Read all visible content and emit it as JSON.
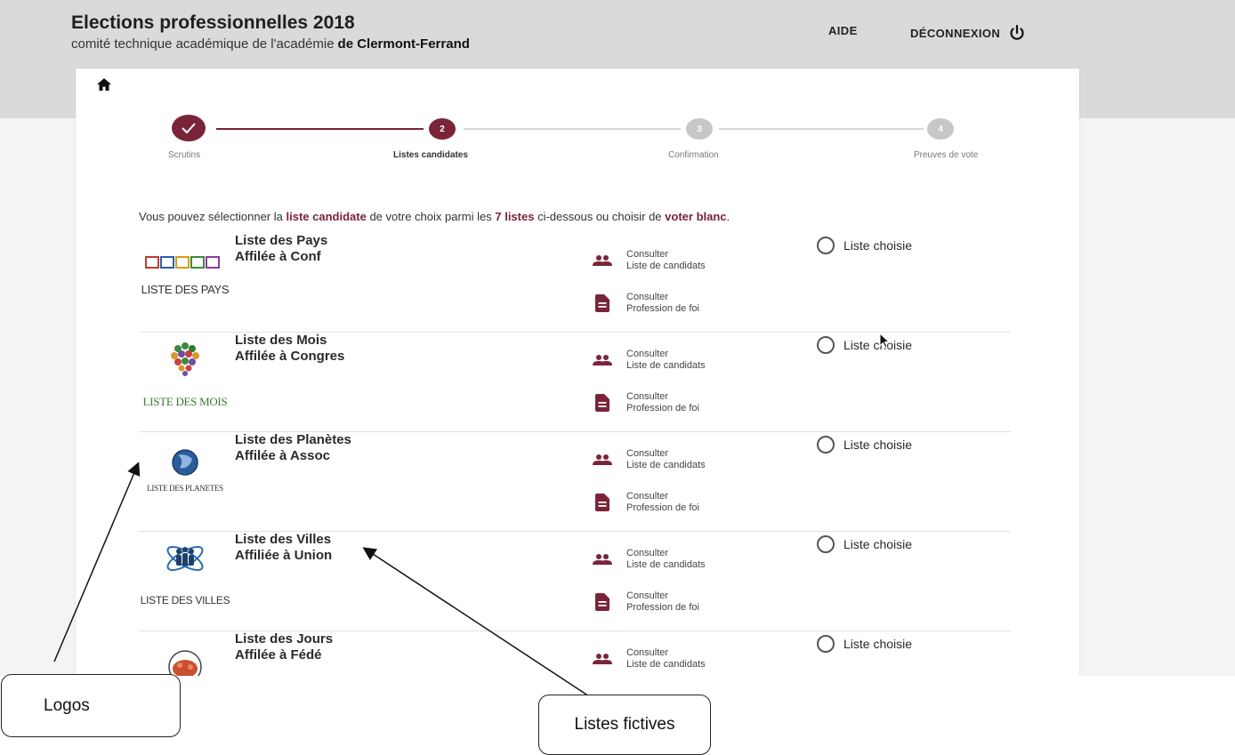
{
  "header": {
    "title": "Elections professionnelles 2018",
    "subtitle_prefix": "comité technique académique de l'académie",
    "subtitle_bold": "de Clermont-Ferrand",
    "help_label": "AIDE",
    "logout_label": "DÉCONNEXION"
  },
  "stepper": {
    "steps": [
      {
        "label": "Scrutins",
        "number": "",
        "state": "done"
      },
      {
        "label": "Listes candidates",
        "number": "2",
        "state": "active"
      },
      {
        "label": "Confirmation",
        "number": "3",
        "state": "todo"
      },
      {
        "label": "Preuves de vote",
        "number": "4",
        "state": "todo"
      }
    ]
  },
  "intro": {
    "part1": "Vous pouvez sélectionner la",
    "em1": "liste candidate",
    "part2": "de votre choix parmi les",
    "em2": "7 listes",
    "part3": "ci-dessous ou choisir de",
    "em3": "voter blanc",
    "part4": "."
  },
  "lists": [
    {
      "name": "Liste des Pays",
      "affiliation": "Affilée à Conf",
      "logo_text": "LISTE DES PAYS",
      "logo_color": "#333333"
    },
    {
      "name": "Liste des Mois",
      "affiliation": "Affilée à Congres",
      "logo_text": "LISTE DES MOIS",
      "logo_color": "#3b7d2e"
    },
    {
      "name": "Liste des Planètes",
      "affiliation": "Affilée à Assoc",
      "logo_text": "LISTE DES PLANETES",
      "logo_color": "#444444"
    },
    {
      "name": "Liste des Villes",
      "affiliation": "Affiliée à Union",
      "logo_text": "LISTE DES VILLES",
      "logo_color": "#333333"
    },
    {
      "name": "Liste des Jours",
      "affiliation": "Affilée à Fédé",
      "logo_text": "",
      "logo_color": "#333333"
    }
  ],
  "actions": {
    "candidates_line1": "Consulter",
    "candidates_line2": "Liste de candidats",
    "faith_line1": "Consulter",
    "faith_line2": "Profession de foi"
  },
  "radio_label": "Liste choisie",
  "callouts": {
    "logos": "Logos",
    "lists": "Listes fictives"
  },
  "colors": {
    "accent": "#7a2439",
    "inactive_step": "#c7c7c7",
    "header_band": "#dadada"
  }
}
